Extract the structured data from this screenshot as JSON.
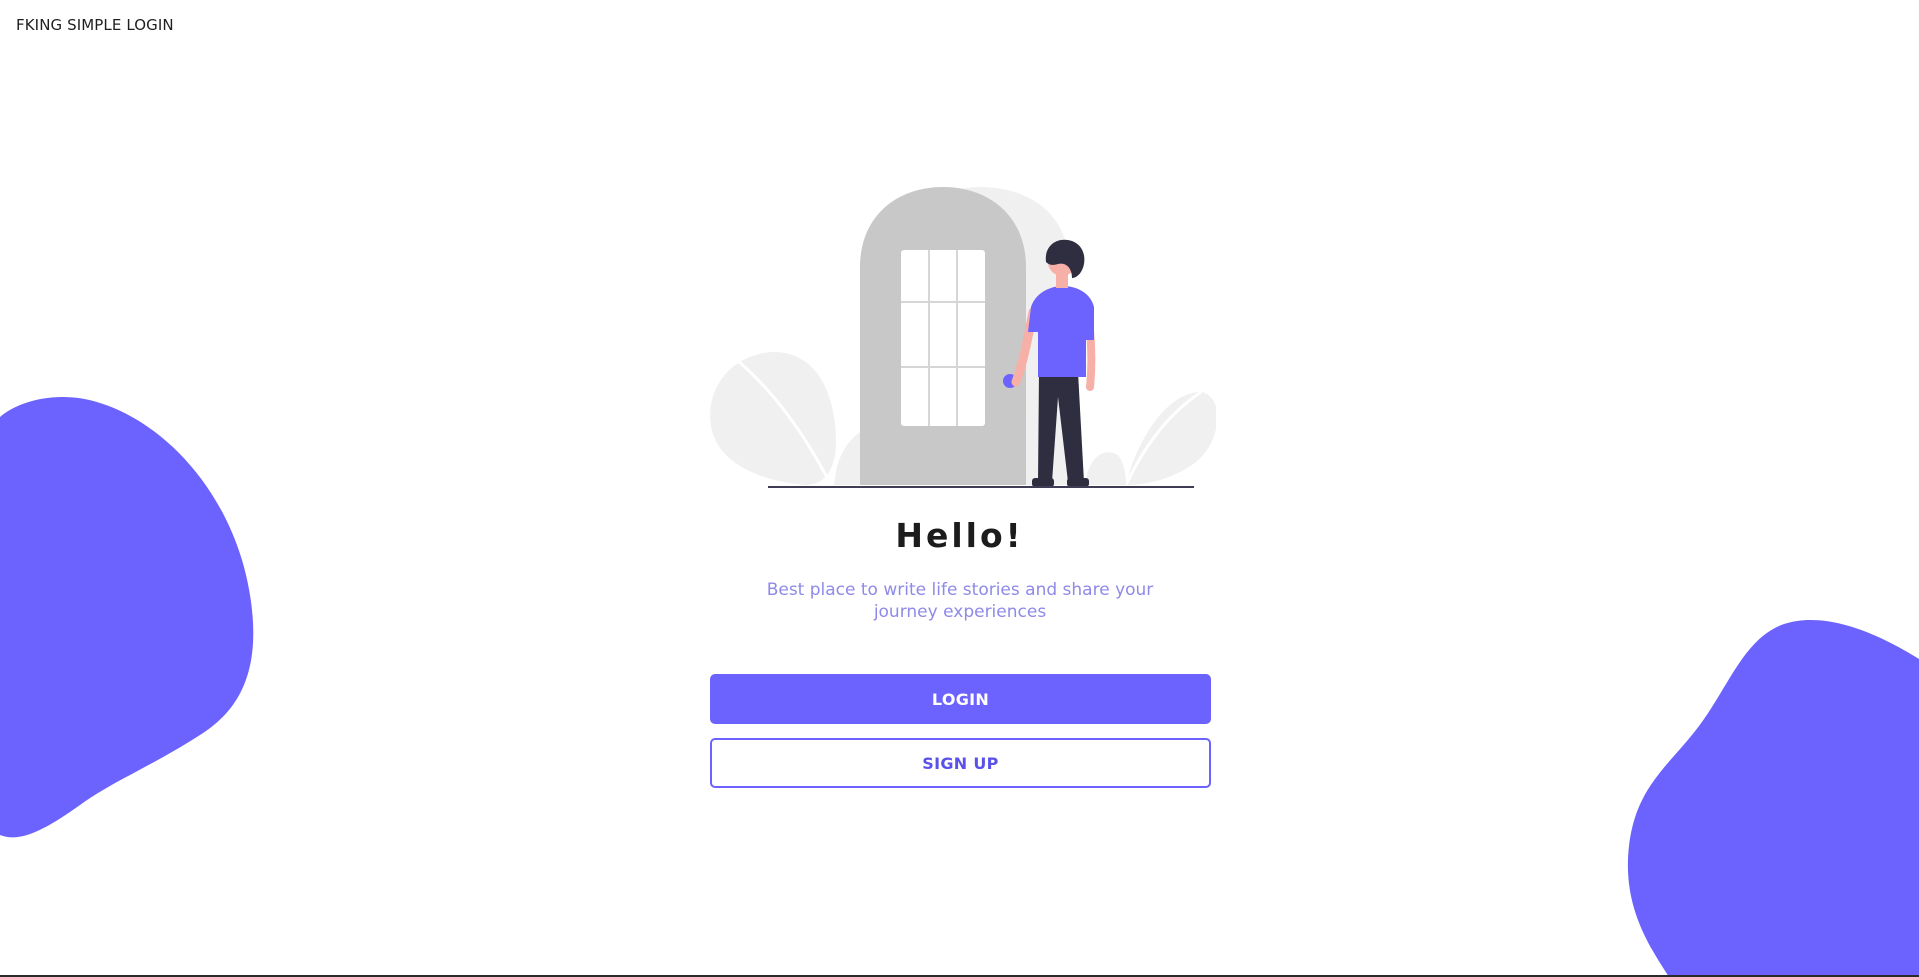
{
  "app": {
    "brand_text": "FKING SIMPLE LOGIN"
  },
  "hero": {
    "heading": "Hello!",
    "tagline": "Best place to write life stories and share your journey experiences",
    "illustration_icon": "person-at-door-illustration"
  },
  "actions": {
    "login_label": "LOGIN",
    "signup_label": "SIGN UP"
  },
  "colors": {
    "accent": "#6c63ff",
    "tagline": "#8f89e8",
    "heading": "#1c1c1c",
    "door": "#c8c8c8",
    "leaf": "#f0f0f0"
  }
}
